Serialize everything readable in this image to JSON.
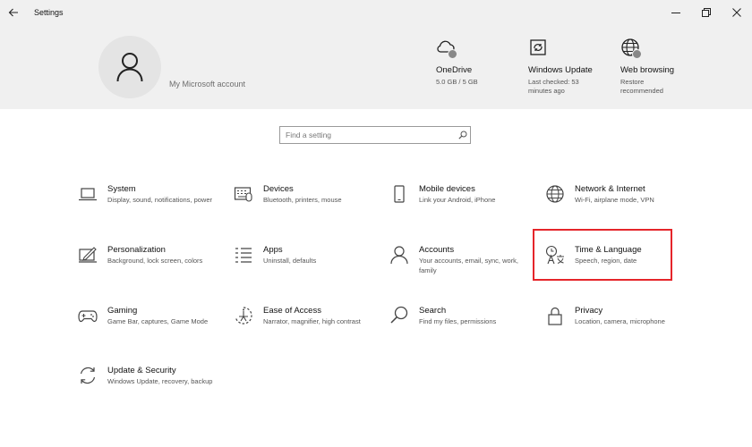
{
  "window": {
    "title": "Settings",
    "controls": [
      "minimize-icon",
      "restore-icon",
      "close-icon"
    ]
  },
  "header": {
    "account_link": "My Microsoft account",
    "quick_links": [
      {
        "title": "OneDrive",
        "subtitle": "5.0 GB / 5 GB",
        "icon": "cloud-icon"
      },
      {
        "title": "Windows Update",
        "subtitle": "Last checked: 53 minutes ago",
        "icon": "update-icon"
      },
      {
        "title": "Web browsing",
        "subtitle": "Restore recommended",
        "icon": "globe-icon"
      }
    ]
  },
  "search": {
    "placeholder": "Find a setting",
    "value": ""
  },
  "categories": [
    {
      "name": "System",
      "description": "Display, sound, notifications, power",
      "icon": "laptop-icon"
    },
    {
      "name": "Devices",
      "description": "Bluetooth, printers, mouse",
      "icon": "keyboard-icon"
    },
    {
      "name": "Mobile devices",
      "description": "Link your Android, iPhone",
      "icon": "phone-icon"
    },
    {
      "name": "Network & Internet",
      "description": "Wi-Fi, airplane mode, VPN",
      "icon": "globe-icon"
    },
    {
      "name": "Personalization",
      "description": "Background, lock screen, colors",
      "icon": "paint-icon"
    },
    {
      "name": "Apps",
      "description": "Uninstall, defaults",
      "icon": "apps-list-icon"
    },
    {
      "name": "Accounts",
      "description": "Your accounts, email, sync, work, family",
      "icon": "person-icon"
    },
    {
      "name": "Time & Language",
      "description": "Speech, region, date",
      "icon": "time-language-icon"
    },
    {
      "name": "Gaming",
      "description": "Game Bar, captures, Game Mode",
      "icon": "gamepad-icon"
    },
    {
      "name": "Ease of Access",
      "description": "Narrator, magnifier, high contrast",
      "icon": "ease-of-access-icon"
    },
    {
      "name": "Search",
      "description": "Find my files, permissions",
      "icon": "search-icon"
    },
    {
      "name": "Privacy",
      "description": "Location, camera, microphone",
      "icon": "lock-icon"
    },
    {
      "name": "Update & Security",
      "description": "Windows Update, recovery, backup",
      "icon": "sync-icon"
    }
  ],
  "colors": {
    "header_background": "#f0f0f0",
    "highlight_border": "#e5252a",
    "status_dot": "#888888"
  }
}
